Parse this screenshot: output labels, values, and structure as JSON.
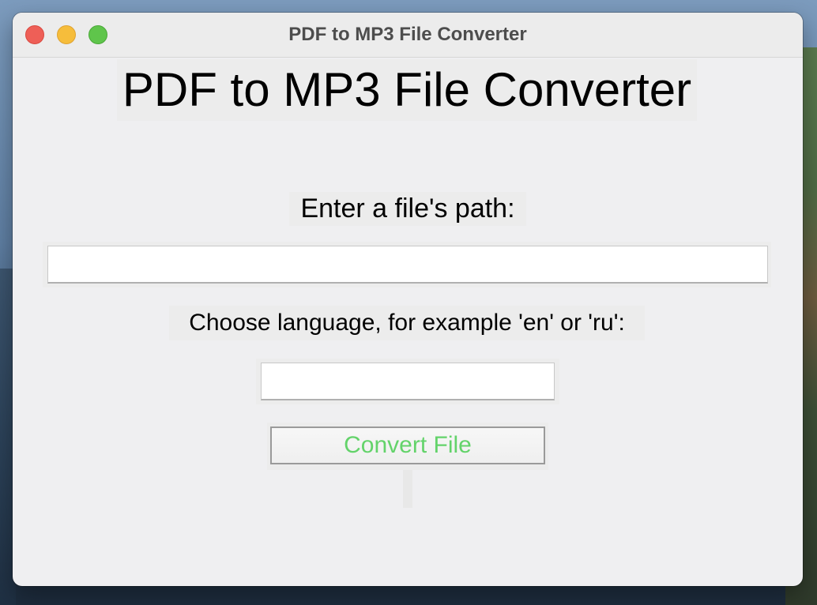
{
  "window": {
    "title": "PDF to MP3 File Converter"
  },
  "main": {
    "heading": "PDF to MP3 File Converter",
    "path_label": "Enter a file's path:",
    "path_value": "",
    "language_label": "Choose language, for example 'en' or 'ru':",
    "language_value": "",
    "convert_button_label": "Convert File",
    "status_text": ""
  },
  "colors": {
    "button_text": "#63d36a",
    "window_background": "#efeff1",
    "traffic_close": "#ee5f57",
    "traffic_minimize": "#f6bd3b",
    "traffic_maximize": "#5fc54b"
  },
  "icons": {
    "close": "close-icon",
    "minimize": "minimize-icon",
    "maximize": "maximize-icon"
  }
}
